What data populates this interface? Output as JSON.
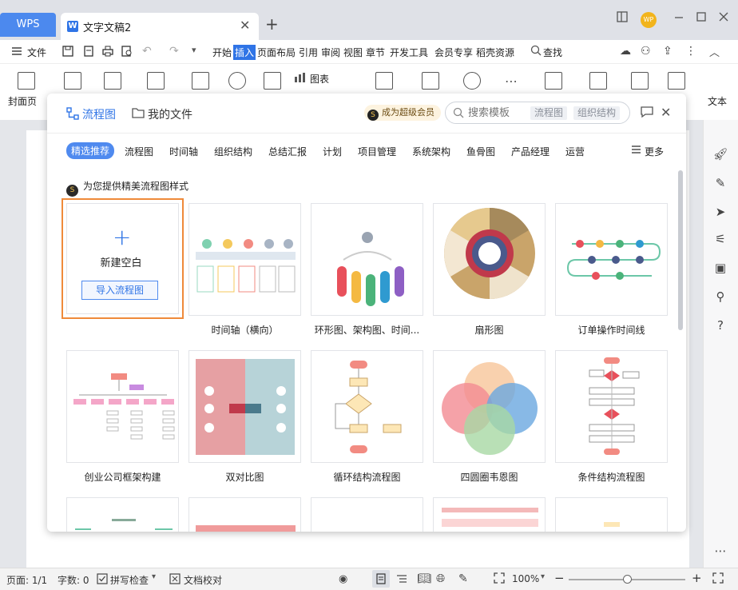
{
  "titlebar": {
    "wps_label": "WPS",
    "doc_tab_title": "文字文稿2",
    "close_glyph": "✕",
    "new_tab_glyph": "+",
    "avatar_text": "WP"
  },
  "menubar": {
    "file_label": "文件",
    "items": [
      "开始",
      "插入",
      "页面布局",
      "引用",
      "审阅",
      "视图",
      "章节",
      "开发工具",
      "会员专享",
      "稻壳资源"
    ],
    "search_label": "查找"
  },
  "ribbon": {
    "cover_label": "封面页",
    "chart_label": "图表",
    "text_label": "文本"
  },
  "modal": {
    "tab_flowchart": "流程图",
    "tab_my_files": "我的文件",
    "vip_label": "成为超级会员",
    "vip_icon_text": "S",
    "search_placeholder": "搜索模板",
    "search_chips": [
      "流程图",
      "组织结构"
    ],
    "close_glyph": "✕",
    "categories": [
      "精选推荐",
      "流程图",
      "时间轴",
      "组织结构",
      "总结汇报",
      "计划",
      "项目管理",
      "系统架构",
      "鱼骨图",
      "产品经理",
      "运营"
    ],
    "more_label": "更多",
    "recommend_text": "为您提供精美流程图样式",
    "new_blank": {
      "plus": "+",
      "label": "新建空白",
      "import_label": "导入流程图"
    },
    "templates_row1": [
      "时间轴（横向）",
      "环形图、架构图、时间...",
      "扇形图",
      "订单操作时间线"
    ],
    "templates_row2": [
      "创业公司框架构建",
      "双对比图",
      "循环结构流程图",
      "四圆圈韦恩图",
      "条件结构流程图"
    ]
  },
  "statusbar": {
    "page_label": "页面: 1/1",
    "word_count": "字数: 0",
    "spellcheck": "拼写检查",
    "proofread": "文档校对",
    "zoom": "100%",
    "zoom_minus": "−",
    "zoom_plus": "+"
  },
  "colors": {
    "accent": "#2f74e6",
    "highlight_border": "#ef8a3a",
    "wps_tab": "#4c89ee"
  }
}
